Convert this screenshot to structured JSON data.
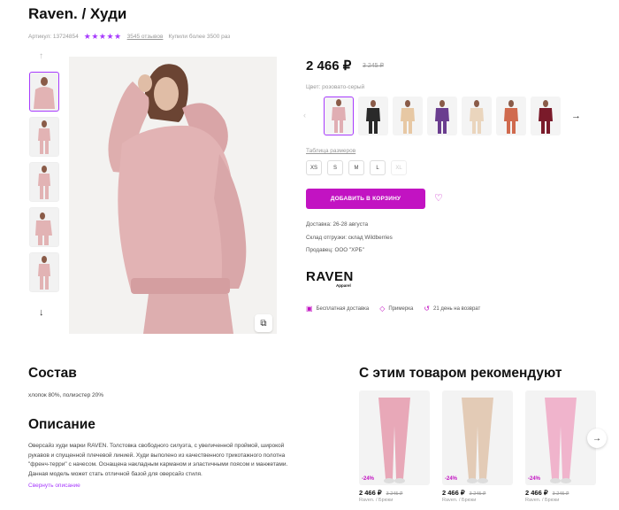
{
  "product": {
    "title": "Raven. / Худи",
    "article": "Артикул: 13724854",
    "stars": "★★★★★",
    "reviews": "3545 отзывов",
    "bought": "Купили более 3500 раз",
    "price": "2 466 ₽",
    "old_price": "3 245 ₽",
    "color_label": "Цвет: розовато-серый",
    "size_table_label": "Таблица размеров",
    "sizes": [
      "XS",
      "S",
      "M",
      "L",
      "XL"
    ],
    "add_to_cart": "ДОБАВИТЬ В КОРЗИНУ",
    "delivery": "Доставка: 26-28 августа",
    "warehouse": "Склад отгрузки: склад Wildberries",
    "seller": "Продавец: ООО \"ХРБ\"",
    "brand": "RAVEN",
    "brand_sub": "Apparel",
    "benefits": [
      "Бесплатная доставка",
      "Примерка",
      "21 день на возврат"
    ]
  },
  "composition": {
    "heading": "Состав",
    "text": "хлопок 80%, полиэстер 20%"
  },
  "description": {
    "heading": "Описание",
    "lines": [
      "Оверсайз худи марки RAVEN. Толстовка свободного силуэта, с увеличенной проймой, широкой",
      "рукавов и спущенной плечевой линией. Худи выполено из качественного трикотажного полотна",
      "\"френч-терри\" с начесом. Оснащена накладным карманом и эластичными поясом и манжетами.",
      "Данная модель может стать отличной базой для оверсайз стиля."
    ],
    "collapse_link": "Свернуть описание"
  },
  "recommend": {
    "heading": "С этим товаром рекомендуют",
    "items": [
      {
        "discount": "-24%",
        "price": "2 466 ₽",
        "old": "3 245 ₽",
        "name": "Raven. / Брюки",
        "color": "#e8a8b8"
      },
      {
        "discount": "-24%",
        "price": "2 466 ₽",
        "old": "3 245 ₽",
        "name": "Raven. / Брюки",
        "color": "#e3cbb6"
      },
      {
        "discount": "-24%",
        "price": "2 466 ₽",
        "old": "3 245 ₽",
        "name": "Raven. / Брюки",
        "color": "#f0b4cc"
      }
    ]
  },
  "colors": {
    "accent": "#c213c2",
    "purple": "#a73afd",
    "hoodie": "#e2b3b4"
  },
  "swatch_colors": [
    "#e0aeb3",
    "#2a2a2a",
    "#e7c8a4",
    "#6a3d8f",
    "#ead5bd",
    "#d06a4e",
    "#7a1a2a"
  ]
}
